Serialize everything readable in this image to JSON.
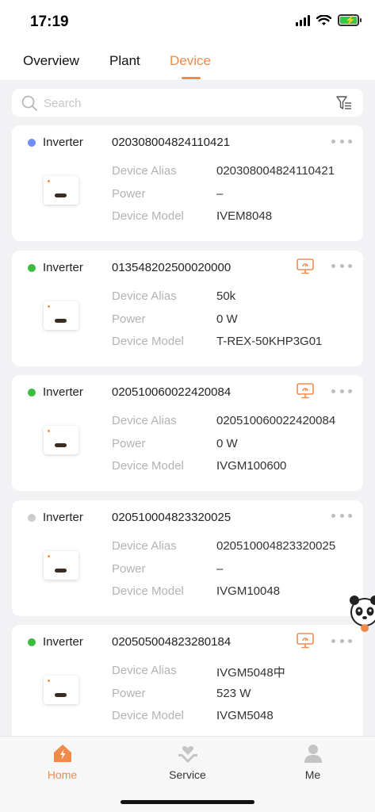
{
  "status": {
    "time": "17:19"
  },
  "tabs": [
    {
      "label": "Overview",
      "active": false
    },
    {
      "label": "Plant",
      "active": false
    },
    {
      "label": "Device",
      "active": true
    }
  ],
  "search": {
    "placeholder": "Search",
    "value": ""
  },
  "field_labels": {
    "alias": "Device Alias",
    "power": "Power",
    "model": "Device Model"
  },
  "colors": {
    "accent": "#f08a4b",
    "online": "#3dbb3d",
    "offline": "#cccccc",
    "standby": "#6e8ff0"
  },
  "devices": [
    {
      "type": "Inverter",
      "sn": "020308004824110421",
      "status": "standby",
      "monitor": false,
      "alias": "020308004824110421",
      "power": "–",
      "model": "IVEM8048"
    },
    {
      "type": "Inverter",
      "sn": "013548202500020000",
      "status": "online",
      "monitor": true,
      "alias": "50k",
      "power": "0 W",
      "model": "T-REX-50KHP3G01"
    },
    {
      "type": "Inverter",
      "sn": "020510060022420084",
      "status": "online",
      "monitor": true,
      "alias": "020510060022420084",
      "power": "0 W",
      "model": "IVGM100600"
    },
    {
      "type": "Inverter",
      "sn": "020510004823320025",
      "status": "offline",
      "monitor": false,
      "alias": "020510004823320025",
      "power": "–",
      "model": "IVGM10048"
    },
    {
      "type": "Inverter",
      "sn": "020505004823280184",
      "status": "online",
      "monitor": true,
      "alias": "IVGM5048中",
      "power": "523 W",
      "model": "IVGM5048"
    }
  ],
  "nav": [
    {
      "label": "Home",
      "icon": "home-icon",
      "active": true
    },
    {
      "label": "Service",
      "icon": "service-icon",
      "active": false
    },
    {
      "label": "Me",
      "icon": "person-icon",
      "active": false
    }
  ]
}
